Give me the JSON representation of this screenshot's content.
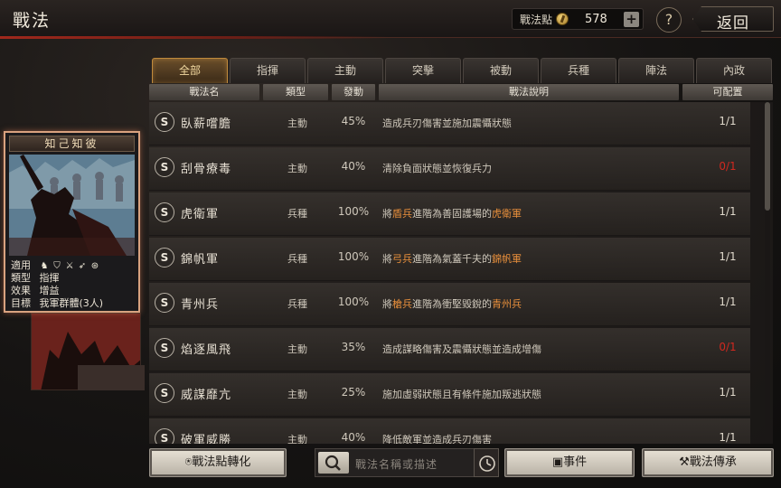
{
  "header": {
    "title": "戰法",
    "points_label": "戰法點",
    "points_value": "578",
    "plus_label": "+",
    "help_label": "?",
    "back_label": "返回"
  },
  "tabs": [
    "全部",
    "指揮",
    "主動",
    "突擊",
    "被動",
    "兵種",
    "陣法",
    "內政"
  ],
  "columns": {
    "name": "戰法名",
    "type": "類型",
    "rate": "發動",
    "desc": "戰法說明",
    "count": "可配置"
  },
  "rows": [
    {
      "badge": "S",
      "name": "臥薪嚐膽",
      "type": "主動",
      "rate": "45%",
      "desc": [
        {
          "t": "造成兵刃傷害並施加震懾狀態"
        }
      ],
      "count": "1/1",
      "count_red": false
    },
    {
      "badge": "S",
      "name": "刮骨療毒",
      "type": "主動",
      "rate": "40%",
      "desc": [
        {
          "t": "清除負面狀態並恢復兵力"
        }
      ],
      "count": "0/1",
      "count_red": true
    },
    {
      "badge": "S",
      "name": "虎衛軍",
      "type": "兵種",
      "rate": "100%",
      "desc": [
        {
          "t": "將"
        },
        {
          "t": "盾兵",
          "hl": true
        },
        {
          "t": "進階為善固護場的"
        },
        {
          "t": "虎衛軍",
          "hl": true
        }
      ],
      "count": "1/1",
      "count_red": false
    },
    {
      "badge": "S",
      "name": "錦帆軍",
      "type": "兵種",
      "rate": "100%",
      "desc": [
        {
          "t": "將"
        },
        {
          "t": "弓兵",
          "hl": true
        },
        {
          "t": "進階為氣蓋千夫的"
        },
        {
          "t": "錦帆軍",
          "hl": true
        }
      ],
      "count": "1/1",
      "count_red": false
    },
    {
      "badge": "S",
      "name": "青州兵",
      "type": "兵種",
      "rate": "100%",
      "desc": [
        {
          "t": "將"
        },
        {
          "t": "槍兵",
          "hl": true
        },
        {
          "t": "進階為衝堅毀銳的"
        },
        {
          "t": "青州兵",
          "hl": true
        }
      ],
      "count": "1/1",
      "count_red": false
    },
    {
      "badge": "S",
      "name": "焰逐風飛",
      "type": "主動",
      "rate": "35%",
      "desc": [
        {
          "t": "造成謀略傷害及震懾狀態並造成增傷"
        }
      ],
      "count": "0/1",
      "count_red": true
    },
    {
      "badge": "S",
      "name": "威謀靡亢",
      "type": "主動",
      "rate": "25%",
      "desc": [
        {
          "t": "施加虛弱狀態且有條件施加叛逃狀態"
        }
      ],
      "count": "1/1",
      "count_red": false
    },
    {
      "badge": "S",
      "name": "破軍威勝",
      "type": "主動",
      "rate": "40%",
      "desc": [
        {
          "t": "降低敵軍並造成兵刃傷害"
        }
      ],
      "count": "1/1",
      "count_red": false
    }
  ],
  "card": {
    "title": "知己知彼",
    "apply_label": "適用",
    "type_label": "類型",
    "type_value": "指揮",
    "effect_label": "效果",
    "effect_value": "增益",
    "target_label": "目標",
    "target_value": "我軍群體(3人)",
    "troop_icons": [
      "horse-icon",
      "shield-icon",
      "crossed-weapons-icon",
      "bow-icon",
      "wheel-icon"
    ]
  },
  "footer": {
    "convert_label": "戰法點轉化",
    "search_placeholder": "戰法名稱或描述",
    "event_label": "事件",
    "inherit_label": "戰法傳承"
  },
  "colors": {
    "highlight": "#e88f3c",
    "alert_red": "#d0281f",
    "active_tab": "#c08a3c",
    "card_border": "#d9a27f"
  }
}
